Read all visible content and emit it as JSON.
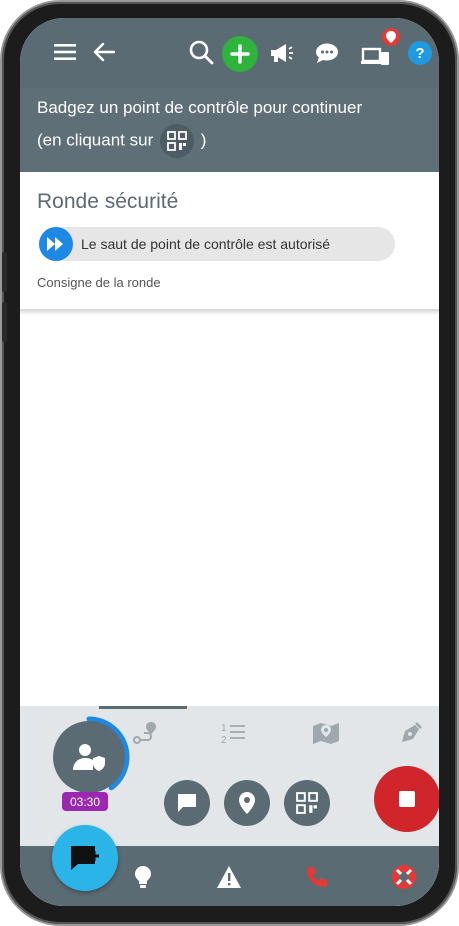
{
  "banner": {
    "line1": "Badgez un point de contrôle pour continuer",
    "line2_prefix": "(en cliquant sur",
    "line2_suffix": ")"
  },
  "round": {
    "title": "Ronde sécurité",
    "chip_text": "Le saut de point de contrôle est autorisé",
    "instruction_link": "Consigne de la ronde"
  },
  "timer": "03:30",
  "icons": {
    "menu": "menu-icon",
    "back": "arrow-left-icon",
    "search": "search-icon",
    "add": "plus-icon",
    "announce": "megaphone-icon",
    "chat": "chat-bubble-icon",
    "devices": "devices-icon",
    "help": "help-icon",
    "skip": "fast-forward-icon"
  },
  "colors": {
    "appbar": "#5b6b73",
    "add_green": "#2eb33d",
    "help_blue": "#1e9be0",
    "stop_red": "#d0252b",
    "timer_purple": "#9c27b0",
    "fab_cyan": "#2bb4e8",
    "progress_blue": "#1e88e5"
  },
  "progress": 0.4
}
